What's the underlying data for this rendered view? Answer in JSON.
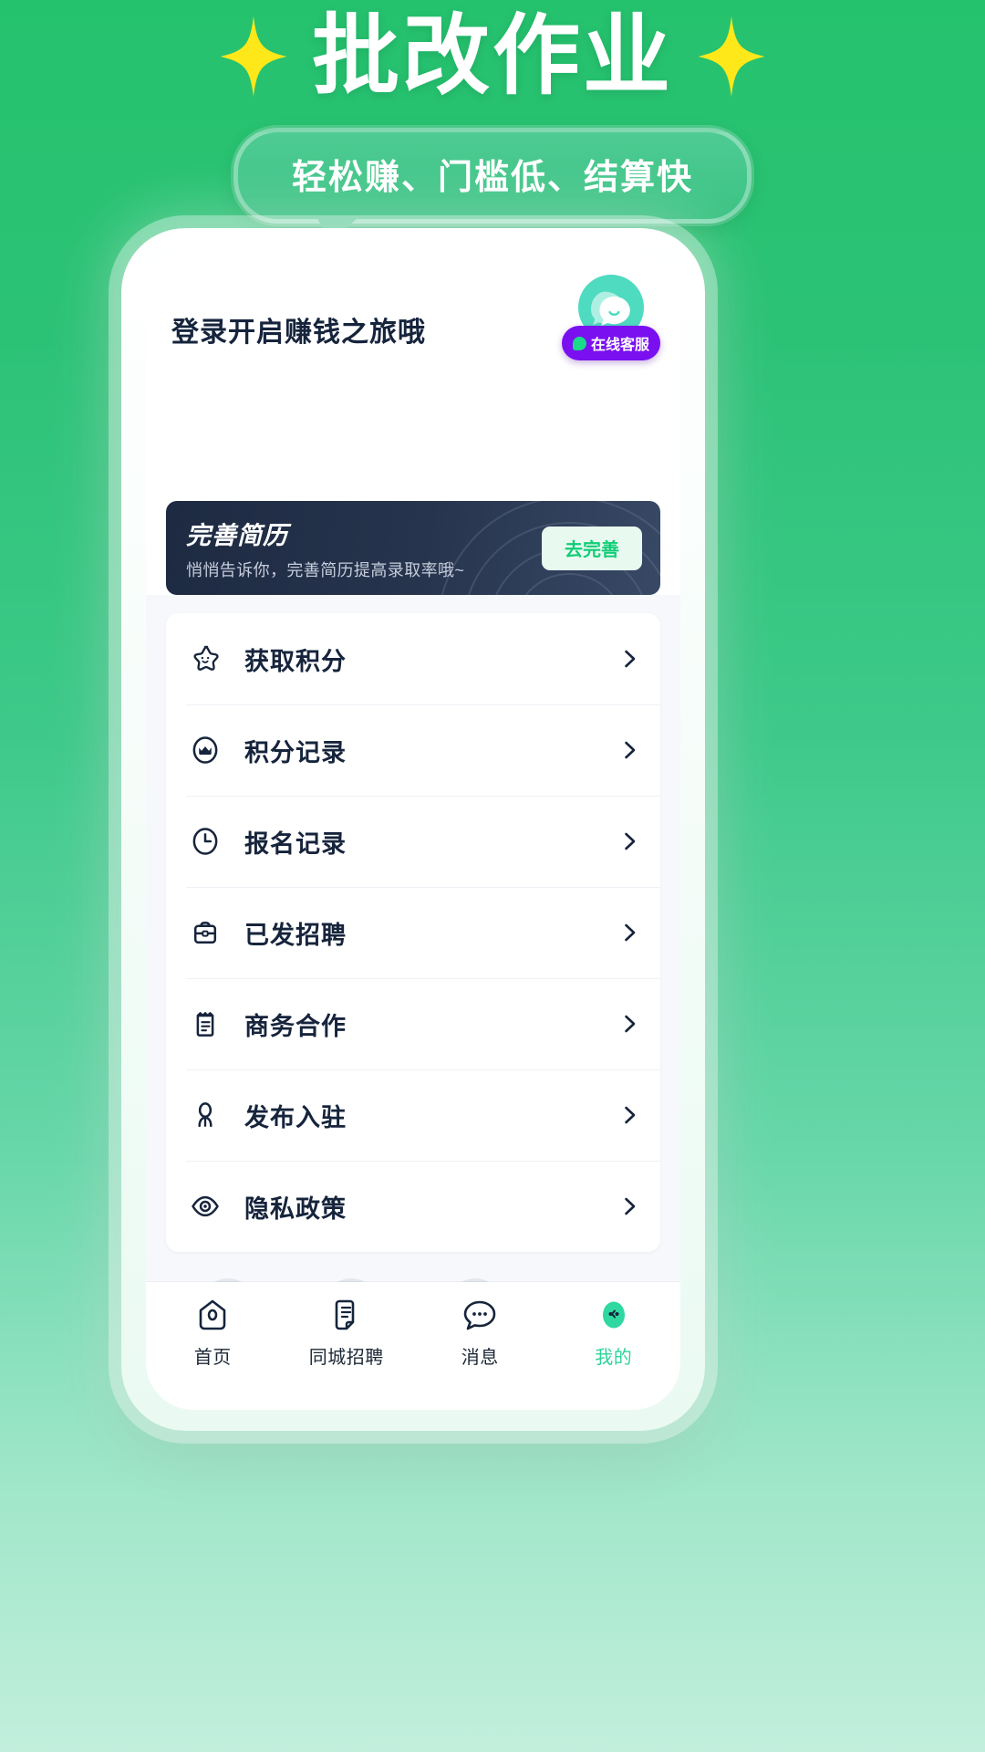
{
  "poster": {
    "title": "批改作业",
    "subtitle": "轻松赚、门槛低、结算快",
    "sparkle_icon": "sparkle-icon",
    "brand_green": "#2bc275",
    "accent_green": "#12cd77"
  },
  "screen": {
    "login_title": "登录开启赚钱之旅哦",
    "customer_service": {
      "label": "在线客服",
      "bubble_icon": "chat-bubble-icon",
      "pill_color": "#7a10f0",
      "bubble_color": "#4fdbc0"
    },
    "resume_banner": {
      "title": "完善简历",
      "subtitle": "悄悄告诉你，完善简历提高录取率哦~",
      "button_label": "去完善",
      "background_color": "#1d2a42",
      "button_text_color": "#12cd77"
    },
    "menu": {
      "items": [
        {
          "label": "获取积分",
          "icon": "star-icon"
        },
        {
          "label": "积分记录",
          "icon": "crown-circle-icon"
        },
        {
          "label": "报名记录",
          "icon": "clock-icon"
        },
        {
          "label": "已发招聘",
          "icon": "briefcase-icon"
        },
        {
          "label": "商务合作",
          "icon": "clipboard-icon"
        },
        {
          "label": "发布入驻",
          "icon": "person-icon"
        },
        {
          "label": "隐私政策",
          "icon": "eye-icon"
        }
      ],
      "chevron_icon": "chevron-right-icon"
    },
    "tabbar": {
      "items": [
        {
          "label": "首页",
          "icon": "home-tag-icon",
          "active": false
        },
        {
          "label": "同城招聘",
          "icon": "document-icon",
          "active": false
        },
        {
          "label": "消息",
          "icon": "message-icon",
          "active": false
        },
        {
          "label": "我的",
          "icon": "profile-avatar-icon",
          "active": true
        }
      ],
      "active_color": "#2fd49a"
    }
  }
}
